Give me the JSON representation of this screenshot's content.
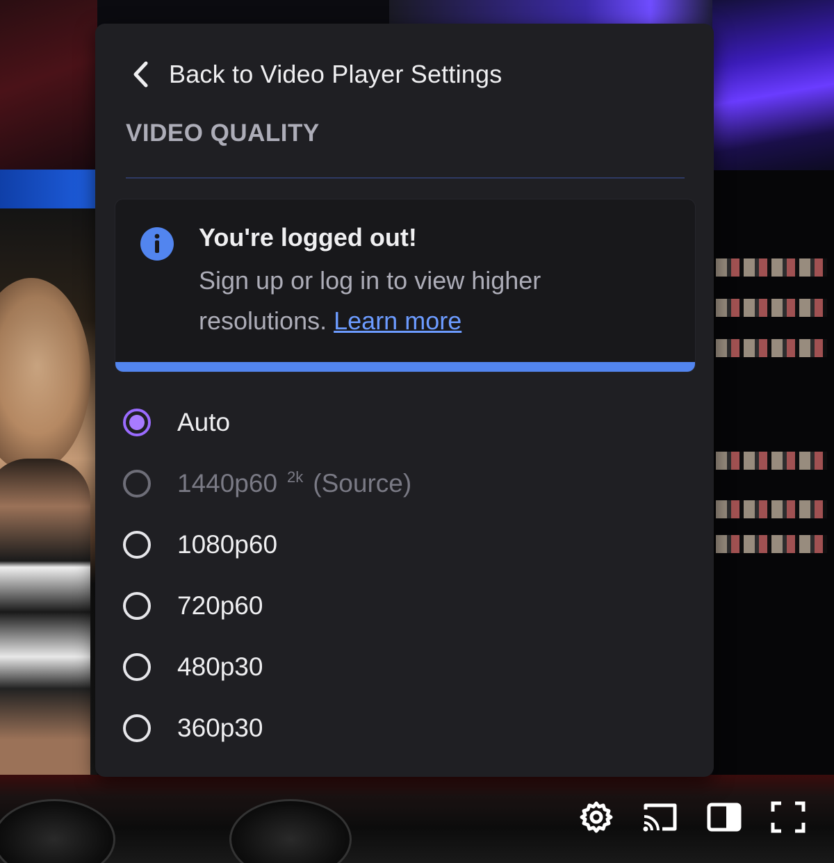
{
  "popover": {
    "back_label": "Back to Video Player Settings",
    "section_title": "VIDEO QUALITY"
  },
  "notice": {
    "icon": "info-icon",
    "title": "You're logged out!",
    "body": "Sign up or log in to view higher resolutions.",
    "link": "Learn more",
    "accent": "#5285ef"
  },
  "quality_options": [
    {
      "label": "Auto",
      "badge": "",
      "suffix": "",
      "selected": true,
      "disabled": false
    },
    {
      "label": "1440p60",
      "badge": "2k",
      "suffix": "(Source)",
      "selected": false,
      "disabled": true
    },
    {
      "label": "1080p60",
      "badge": "",
      "suffix": "",
      "selected": false,
      "disabled": false
    },
    {
      "label": "720p60",
      "badge": "",
      "suffix": "",
      "selected": false,
      "disabled": false
    },
    {
      "label": "480p30",
      "badge": "",
      "suffix": "",
      "selected": false,
      "disabled": false
    },
    {
      "label": "360p30",
      "badge": "",
      "suffix": "",
      "selected": false,
      "disabled": false
    }
  ],
  "player_controls": [
    "gear-icon",
    "cast-icon",
    "theatre-mode-icon",
    "fullscreen-icon"
  ],
  "colors": {
    "panel_bg": "#1f1f23",
    "selected_radio": "#a87bff",
    "link": "#6c9bff"
  }
}
